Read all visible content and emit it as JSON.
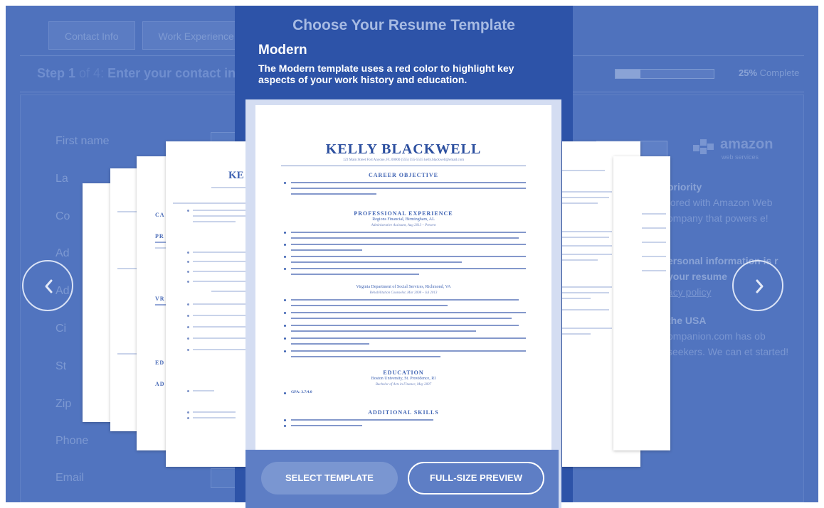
{
  "form": {
    "tabs": [
      {
        "label": "Contact Info"
      },
      {
        "label": "Work Experience"
      }
    ],
    "step": {
      "current": "Step 1",
      "of_total": "of 4:",
      "title": "Enter your contact in"
    },
    "progress": {
      "percent_label": "25%",
      "suffix": "Complete",
      "fraction": 0.25
    },
    "fields": [
      {
        "label": "First name"
      },
      {
        "label": "La"
      },
      {
        "label": "Co"
      },
      {
        "label": "Ad"
      },
      {
        "label": "Ad"
      },
      {
        "label": "Ci"
      },
      {
        "label": "St"
      },
      {
        "label": "Zip"
      },
      {
        "label": "Phone"
      },
      {
        "label": "Email"
      }
    ],
    "sidebar": {
      "aws_word": "amazon",
      "aws_sub": "web services",
      "p1_title": "priority",
      "p1_body": "tored with Amazon Web ompany that powers e!",
      "p2_title": "ersonal information is r your resume",
      "p2_link": "acy policy",
      "p3_title": "the USA",
      "p3_body": "ompanion.com has ob seekers. We can et started!"
    }
  },
  "modal": {
    "title": "Choose Your Resume Template",
    "template_name": "Modern",
    "template_description": "The Modern template uses a red color to highlight key aspects of your work history and education.",
    "buttons": {
      "select": "SELECT TEMPLATE",
      "preview": "FULL-SIZE PREVIEW"
    }
  },
  "resume": {
    "name": "KELLY BLACKWELL",
    "contact": "123 Main Street   Fort Anyone, FL  00000     (555) 555-5555     kelly.blackwell@email.com",
    "sections": {
      "objective": "CAREER OBJECTIVE",
      "experience": "PROFESSIONAL EXPERIENCE",
      "exp1_org": "Regions Financial, Birmingham, AL",
      "exp1_role": "Administrative Assistant, Aug 2013 – Present",
      "exp2_org": "Virginia Department of Social Services, Richmond, VA",
      "exp2_role": "Rehabilitation Counselor, Mar 2008 – Jul 2013",
      "education": "EDUCATION",
      "edu_school": "Boston University, St. Providence, RI",
      "edu_degree": "Bachelor of Arts in Finance, May 2007",
      "gpa": "GPA: 3.7/4.0",
      "skills": "ADDITIONAL SKILLS",
      "side_name_fragment": "KE"
    }
  },
  "colors": {
    "overlay": "#4f72bd",
    "modal": "#2d53a8",
    "accent_text": "#3f63b3"
  },
  "icons": {
    "prev": "chevron-left-icon",
    "next": "chevron-right-icon"
  }
}
